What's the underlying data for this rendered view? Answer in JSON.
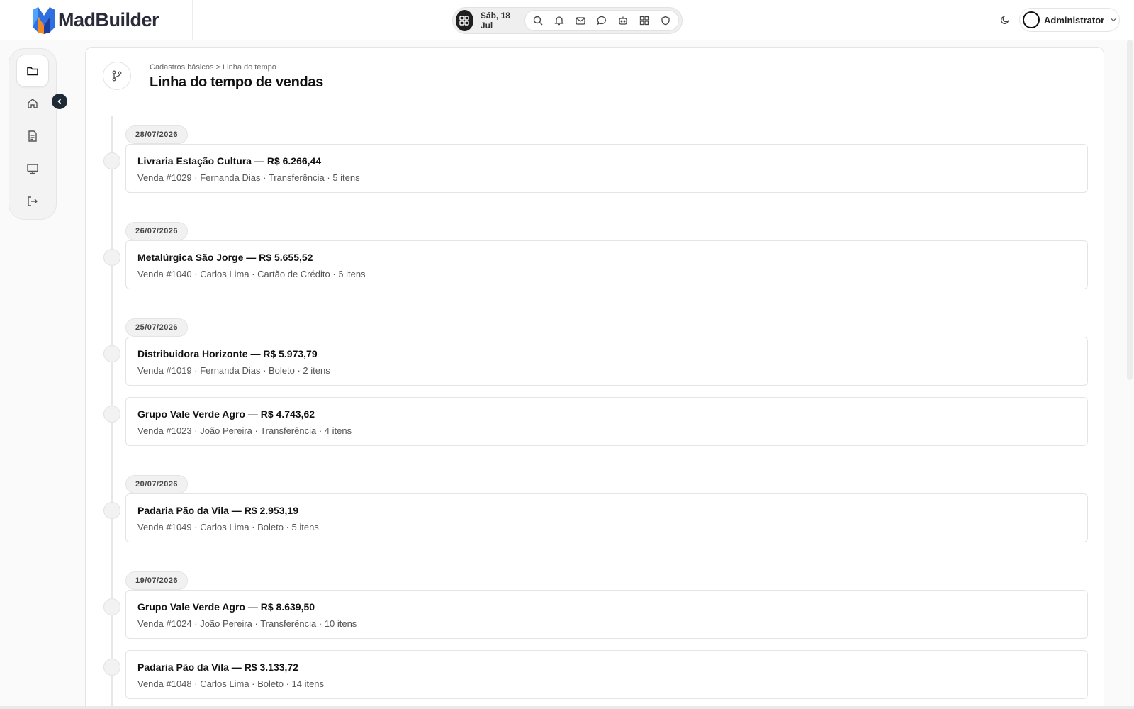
{
  "brand": {
    "name": "MadBuilder"
  },
  "header": {
    "date": "Sáb, 18 Jul",
    "icons": [
      "apps-icon",
      "search-icon",
      "bell-icon",
      "mail-icon",
      "chat-icon",
      "bot-icon",
      "grid-icon",
      "shield-icon",
      "moon-icon"
    ],
    "user": {
      "name": "Administrator"
    }
  },
  "sidebar": {
    "items": [
      {
        "icon": "folder-icon",
        "active": true
      },
      {
        "icon": "home-icon",
        "active": false
      },
      {
        "icon": "document-icon",
        "active": false
      },
      {
        "icon": "monitor-icon",
        "active": false
      },
      {
        "icon": "logout-icon",
        "active": false
      }
    ]
  },
  "page": {
    "breadcrumb": "Cadastros básicos > Linha do tempo",
    "title": "Linha do tempo de vendas"
  },
  "timeline": {
    "dates": [
      "28/07/2026",
      "26/07/2026",
      "25/07/2026",
      "20/07/2026",
      "19/07/2026"
    ],
    "entries": [
      {
        "title": "Livraria Estação Cultura — R$ 6.266,44",
        "details": "Venda #1029 · Fernanda Dias · Transferência · 5 itens"
      },
      {
        "title": "Metalúrgica São Jorge — R$ 5.655,52",
        "details": "Venda #1040 · Carlos Lima · Cartão de Crédito · 6 itens"
      },
      {
        "title": "Distribuidora Horizonte — R$ 5.973,79",
        "details": "Venda #1019 · Fernanda Dias · Boleto · 2 itens"
      },
      {
        "title": "Grupo Vale Verde Agro — R$ 4.743,62",
        "details": "Venda #1023 · João Pereira · Transferência · 4 itens"
      },
      {
        "title": "Padaria Pão da Vila — R$ 2.953,19",
        "details": "Venda #1049 · Carlos Lima · Boleto · 5 itens"
      },
      {
        "title": "Grupo Vale Verde Agro — R$ 8.639,50",
        "details": "Venda #1024 · João Pereira · Transferência · 10 itens"
      },
      {
        "title": "Padaria Pão da Vila — R$ 3.133,72",
        "details": "Venda #1048 · Carlos Lima · Boleto · 14 itens"
      }
    ]
  },
  "colors": {
    "accent_dark": "#1f1f1f",
    "logo_blue": "#2f6fe0",
    "logo_orange": "#f08a24"
  }
}
